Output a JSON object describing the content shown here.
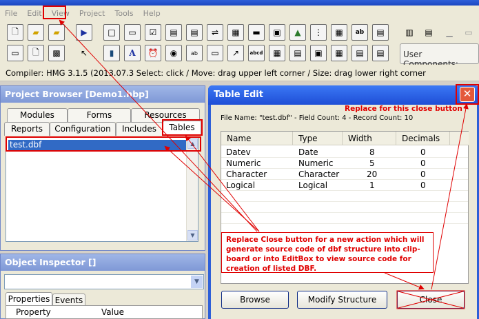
{
  "menu": [
    "File",
    "Edit",
    "View",
    "Project",
    "Tools",
    "Help"
  ],
  "toolbar": {
    "row1": [
      "new-file-icon",
      "open-folder-icon",
      "new-folder-icon",
      "run-icon",
      "frame-icon",
      "button-icon",
      "checkbox-icon",
      "editbox-icon",
      "listbox-icon",
      "combo-icon",
      "grid-icon",
      "progress-icon",
      "image-box-icon",
      "picture-icon",
      "tree-icon",
      "datepicker-icon",
      "label-ab-icon",
      "richedit-icon",
      "toolbar-icon",
      "menu-icon",
      "align-icon",
      "timer-extra-icon"
    ],
    "row2": [
      "window-icon",
      "page-icon",
      "browse-icon",
      "activex-icon",
      "label-a-icon",
      "timer-icon",
      "radio-icon",
      "textbox-icon",
      "calendar-icon",
      "hyperlink-icon",
      "report-icon",
      "spreadsheet-icon",
      "tab-icon",
      "playback-icon",
      "animate-icon"
    ],
    "user_components_label": "User Components:"
  },
  "status": "Compiler: HMG 3.1.5 (2013.07.3   Select: click / Move: drag upper left corner / Size: drag lower right corner",
  "project_browser": {
    "title": "Project Browser [Demo1.hbp]",
    "tabs_row1": [
      "Modules",
      "Forms",
      "Resources"
    ],
    "tabs_row2": [
      "Reports",
      "Configuration",
      "Includes",
      "Tables"
    ],
    "tables": [
      "test.dbf"
    ]
  },
  "object_inspector": {
    "title": "Object Inspector []",
    "tabs": [
      "Properties",
      "Events"
    ],
    "columns": [
      "Property",
      "Value"
    ]
  },
  "table_edit": {
    "title": "Table Edit",
    "close_glyph": "✕",
    "file_info": "File Name: \"test.dbf\"  -  Field Count: 4  -  Record Count: 10",
    "columns": [
      "Name",
      "Type",
      "Width",
      "Decimals"
    ],
    "rows": [
      [
        "Datev",
        "Date",
        "8",
        "0"
      ],
      [
        "Numeric",
        "Numeric",
        "5",
        "0"
      ],
      [
        "Character",
        "Character",
        "20",
        "0"
      ],
      [
        "Logical",
        "Logical",
        "1",
        "0"
      ]
    ],
    "buttons": {
      "browse": "Browse",
      "modify": "Modify Structure",
      "close": "Close"
    }
  },
  "annotations": {
    "close_note": "Replace for this close button",
    "action_note": "Replace Close button for a new action which will generate source code of dbf structure into clip-board or into EditBox to view source code for creation of listed DBF.",
    "color": "#e00000"
  }
}
